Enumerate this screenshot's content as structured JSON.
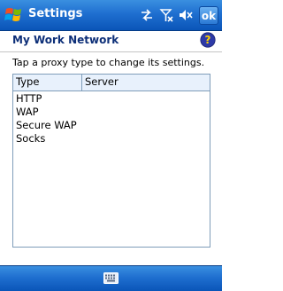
{
  "titlebar": {
    "title": "Settings",
    "ok_label": "ok",
    "icons": [
      "start-menu-icon",
      "connectivity-icon",
      "signal-off-icon",
      "volume-muted-icon"
    ]
  },
  "page": {
    "title": "My Work Network",
    "help_icon": "help-icon"
  },
  "instructions": "Tap a proxy type to change its settings.",
  "proxy_list": {
    "columns": [
      "Type",
      "Server"
    ],
    "rows": [
      {
        "type": "HTTP",
        "server": ""
      },
      {
        "type": "WAP",
        "server": ""
      },
      {
        "type": "Secure WAP",
        "server": ""
      },
      {
        "type": "Socks",
        "server": ""
      }
    ]
  },
  "bottombar": {
    "icon": "keyboard-icon"
  },
  "colors": {
    "titlebar": "#1f6fd0",
    "page_title": "#0d2f78",
    "list_header": "#e8f1fc",
    "list_border": "#7f9db9"
  }
}
